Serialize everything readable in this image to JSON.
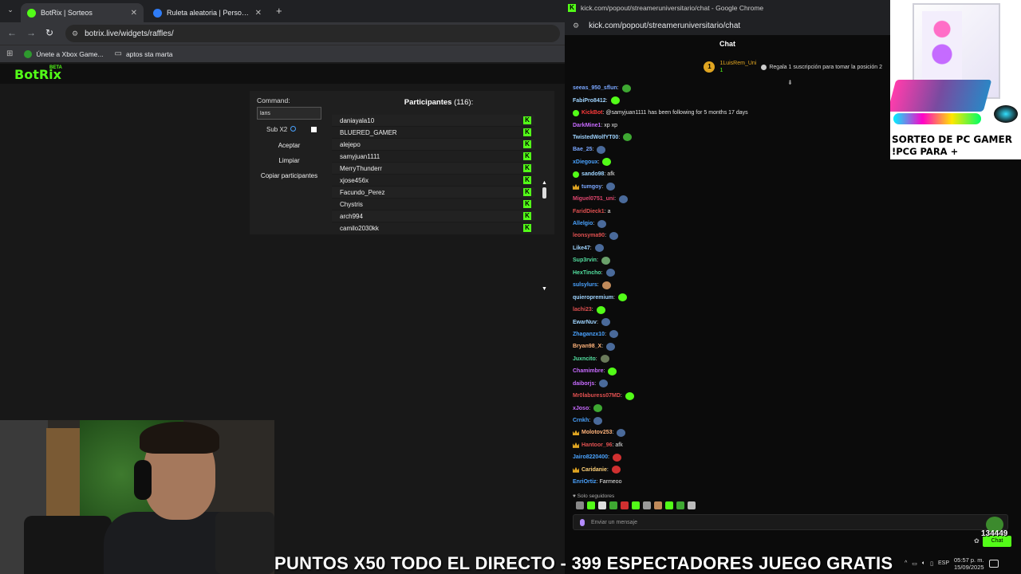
{
  "left_browser": {
    "tabs": [
      {
        "title": "BotRix | Sorteos",
        "favicon_color": "#53fc18"
      },
      {
        "title": "Ruleta aleatoria | Personaliza y",
        "favicon_color": "#2f7cf6"
      }
    ],
    "url": "botrix.live/widgets/raffles/",
    "bookmarks": [
      "Únete a Xbox Game...",
      "aptos sta marta"
    ]
  },
  "botrix": {
    "logo": "BotRix",
    "beta": "BETA",
    "command_label": "Command:",
    "command_value": "laris",
    "sub_label": "Sub X2",
    "buttons": {
      "accept": "Aceptar",
      "clear": "Limpiar",
      "copy": "Copiar participantes"
    },
    "participants_title": "Participantes",
    "participants_count": "(116):",
    "participants": [
      "daniayala10",
      "BLUERED_GAMER",
      "alejepo",
      "samyjuan1111",
      "MerryThunderr",
      "xjose456x",
      "Facundo_Perez",
      "Chystris",
      "arch994",
      "camilo2030kk"
    ]
  },
  "chat_window": {
    "titlebar": "kick.com/popout/streameruniversitario/chat - Google Chrome",
    "url": "kick.com/popout/streameruniversitario/chat",
    "header": "Chat",
    "pinned_user": "1LuisRem_Uni",
    "pinned_count": "1",
    "pinned_badge": "1",
    "pinned_message": "Regala 1 suscripción para tomar la posición 2",
    "messages": [
      {
        "user": "seeas_950_sflun",
        "text": ":",
        "color": "#7aa7ff",
        "emote": "#3ea832"
      },
      {
        "user": "FabiPro8412",
        "text": ":",
        "color": "#9fd4ff",
        "emote": "#53fc18"
      },
      {
        "user": "KickBot",
        "text": ": @samyjuan1111 has been following for 5 months 17 days",
        "color": "#ff3b3b",
        "badge": "#53fc18"
      },
      {
        "user": "DarkMine1",
        "text": ": xp xp",
        "color": "#c86bff"
      },
      {
        "user": "TwistedWolfYT00",
        "text": ":",
        "color": "#9fd4ff",
        "emote": "#3ea832"
      },
      {
        "user": "Bae_25",
        "text": ":",
        "color": "#7aa7ff",
        "emote": "#4a6a9a"
      },
      {
        "user": "xDiegoux",
        "text": ":",
        "color": "#4aa3ff",
        "emote": "#53fc18"
      },
      {
        "user": "sando98",
        "text": ": afk",
        "color": "#9fd4ff",
        "badge": "#53fc18"
      },
      {
        "user": "tumgoy",
        "text": ":",
        "color": "#7aa7ff",
        "crown": true,
        "emote": "#4a6a9a"
      },
      {
        "user": "Miguel0751_uni",
        "text": ":",
        "color": "#e0466e",
        "emote": "#4a6a9a"
      },
      {
        "user": "FaridDieck1",
        "text": ": a",
        "color": "#e05050"
      },
      {
        "user": "Allelgio",
        "text": ":",
        "color": "#4aa3ff",
        "emote": "#4a6a9a"
      },
      {
        "user": "leonsyma90",
        "text": ":",
        "color": "#e05050",
        "emote": "#4a6a9a"
      },
      {
        "user": "Like47",
        "text": ":",
        "color": "#9fd4ff",
        "emote": "#4a6a9a"
      },
      {
        "user": "Sup3rvin",
        "text": ":",
        "color": "#53e0a0",
        "emote": "#6aa06a"
      },
      {
        "user": "HexTincho",
        "text": ":",
        "color": "#53e0a0",
        "emote": "#4a6a9a"
      },
      {
        "user": "sulsylurs",
        "text": ":",
        "color": "#4aa3ff",
        "emote": "#c08a5a"
      },
      {
        "user": "quieropremium",
        "text": ":",
        "color": "#9fd4ff",
        "emote": "#53fc18"
      },
      {
        "user": "lachi23",
        "text": ":",
        "color": "#e05050",
        "emote": "#53fc18"
      },
      {
        "user": "EwarNuv",
        "text": ":",
        "color": "#9fd4ff",
        "emote": "#4a6a9a"
      },
      {
        "user": "Zhaganzx10",
        "text": ":",
        "color": "#4aa3ff",
        "emote": "#4a6a9a"
      },
      {
        "user": "Bryan98_X",
        "text": ":",
        "color": "#ffb37a",
        "emote": "#4a6a9a"
      },
      {
        "user": "Juxncito",
        "text": ":",
        "color": "#53e0a0",
        "emote": "#6a7a5a"
      },
      {
        "user": "Chamimbre",
        "text": ":",
        "color": "#c86bff",
        "emote": "#53fc18"
      },
      {
        "user": "daiborjs",
        "text": ":",
        "color": "#c86bff",
        "emote": "#4a6a9a"
      },
      {
        "user": "Mr0laburess07MD",
        "text": ":",
        "color": "#e05050",
        "emote": "#53fc18"
      },
      {
        "user": "xJoso",
        "text": ":",
        "color": "#c86bff",
        "emote": "#3ea832"
      },
      {
        "user": "Crnkh",
        "text": ":",
        "color": "#4aa3ff",
        "emote": "#4a6a9a"
      },
      {
        "user": "Molotov253",
        "text": ":",
        "color": "#ffb37a",
        "crown": true,
        "emote": "#4a6a9a"
      },
      {
        "user": "Hantoor_96",
        "text": ": afk",
        "color": "#e05050",
        "crown": true
      },
      {
        "user": "Jairo8220400",
        "text": ":",
        "color": "#4aa3ff",
        "emote": "#d03030"
      },
      {
        "user": "Caridanie",
        "text": ":",
        "color": "#ffd27a",
        "crown": true,
        "emote": "#d03030"
      },
      {
        "user": "EnriOrtiz",
        "text": ": Farmeoo",
        "color": "#4aa3ff"
      }
    ],
    "followers_only": "Solo seguidores",
    "input_placeholder": "Enviar un mensaje",
    "send_label": "Chat"
  },
  "ad": {
    "line1": "SORTEO DE PC GAMER",
    "line2": "!PCG PARA + INFORMACION"
  },
  "ticker": "PUNTOS X50 TODO EL DIRECTO - 399 ESPECTADORES JUEGO GRATIS",
  "overlay_counter": "134449",
  "tray": {
    "lang": "ESP",
    "time": "05:57 p. m.",
    "date": "15/09/2025"
  },
  "colors": {
    "kick_green": "#53fc18",
    "gold": "#e0a521"
  }
}
